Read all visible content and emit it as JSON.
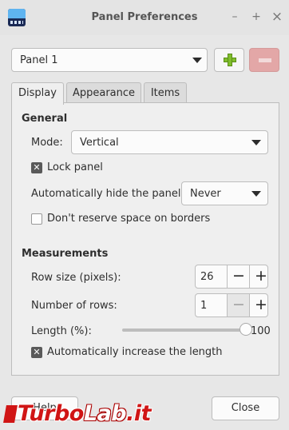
{
  "window": {
    "title": "Panel Preferences",
    "app_icon": "panel-app-icon",
    "controls": {
      "minimize": "–",
      "maximize": "+",
      "close": "×"
    }
  },
  "panel_selector": {
    "value": "Panel 1",
    "add_icon": "plus-icon",
    "remove_icon": "minus-icon"
  },
  "tabs": [
    {
      "label": "Display",
      "active": true
    },
    {
      "label": "Appearance",
      "active": false
    },
    {
      "label": "Items",
      "active": false
    }
  ],
  "general": {
    "heading": "General",
    "mode_label": "Mode:",
    "mode_value": "Vertical",
    "lock_panel_label": "Lock panel",
    "lock_panel_checked": true,
    "autohide_label": "Automatically hide the panel:",
    "autohide_value": "Never",
    "dont_reserve_label": "Don't reserve space on borders",
    "dont_reserve_checked": false
  },
  "measurements": {
    "heading": "Measurements",
    "row_size_label": "Row size (pixels):",
    "row_size_value": "26",
    "rows_label": "Number of rows:",
    "rows_value": "1",
    "length_label": "Length (%):",
    "length_value": "100",
    "auto_increase_label": "Automatically increase the length",
    "auto_increase_checked": true
  },
  "footer": {
    "help_label": "Help",
    "close_label": "Close"
  },
  "watermark": {
    "part1": "Turbo",
    "part2": "Lab",
    "part3": ".it"
  },
  "colors": {
    "add_green": "#7fbd2b",
    "remove_red": "#e3a7a7",
    "watermark_red": "#d01515"
  }
}
